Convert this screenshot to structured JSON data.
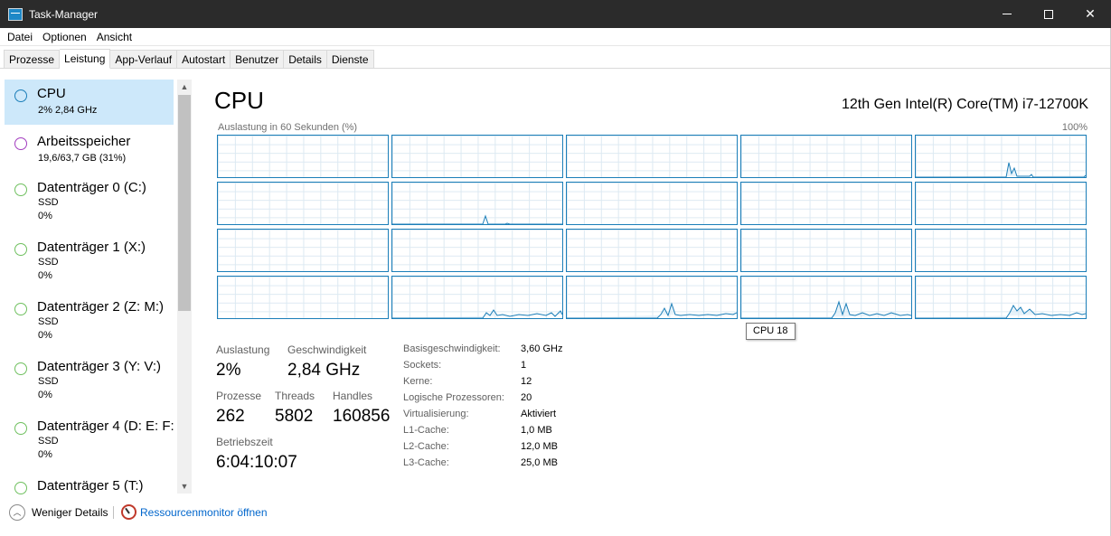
{
  "window": {
    "title": "Task-Manager"
  },
  "menu": [
    "Datei",
    "Optionen",
    "Ansicht"
  ],
  "tabs": [
    "Prozesse",
    "Leistung",
    "App-Verlauf",
    "Autostart",
    "Benutzer",
    "Details",
    "Dienste"
  ],
  "active_tab": "Leistung",
  "sidebar": {
    "items": [
      {
        "name": "CPU",
        "sub1": "2%  2,84 GHz",
        "sub2": "",
        "color": "#1b7eb8",
        "active": true
      },
      {
        "name": "Arbeitsspeicher",
        "sub1": "19,6/63,7 GB (31%)",
        "sub2": "",
        "color": "#a23cbf",
        "active": false
      },
      {
        "name": "Datenträger 0 (C:)",
        "sub1": "SSD",
        "sub2": "0%",
        "color": "#6fc05f",
        "active": false
      },
      {
        "name": "Datenträger 1 (X:)",
        "sub1": "SSD",
        "sub2": "0%",
        "color": "#6fc05f",
        "active": false
      },
      {
        "name": "Datenträger 2 (Z: M:)",
        "sub1": "SSD",
        "sub2": "0%",
        "color": "#6fc05f",
        "active": false
      },
      {
        "name": "Datenträger 3 (Y: V:)",
        "sub1": "SSD",
        "sub2": "0%",
        "color": "#6fc05f",
        "active": false
      },
      {
        "name": "Datenträger 4 (D: E: F:",
        "sub1": "SSD",
        "sub2": "0%",
        "color": "#6fc05f",
        "active": false
      },
      {
        "name": "Datenträger 5 (T:)",
        "sub1": "",
        "sub2": "",
        "color": "#6fc05f",
        "active": false
      }
    ]
  },
  "main": {
    "title": "CPU",
    "model": "12th Gen Intel(R) Core(TM) i7-12700K",
    "graph_label": "Auslastung in 60 Sekunden (%)",
    "graph_max": "100%",
    "tooltip": "CPU 18",
    "stats": {
      "auslastung_label": "Auslastung",
      "auslastung": "2%",
      "geschwindigkeit_label": "Geschwindigkeit",
      "geschwindigkeit": "2,84 GHz",
      "prozesse_label": "Prozesse",
      "prozesse": "262",
      "threads_label": "Threads",
      "threads": "5802",
      "handles_label": "Handles",
      "handles": "160856",
      "betriebszeit_label": "Betriebszeit",
      "betriebszeit": "6:04:10:07"
    },
    "specs": [
      {
        "label": "Basisgeschwindigkeit:",
        "value": "3,60 GHz"
      },
      {
        "label": "Sockets:",
        "value": "1"
      },
      {
        "label": "Kerne:",
        "value": "12"
      },
      {
        "label": "Logische Prozessoren:",
        "value": "20"
      },
      {
        "label": "Virtualisierung:",
        "value": "Aktiviert"
      },
      {
        "label": "L1-Cache:",
        "value": "1,0 MB"
      },
      {
        "label": "L2-Cache:",
        "value": "12,0 MB"
      },
      {
        "label": "L3-Cache:",
        "value": "25,0 MB"
      }
    ]
  },
  "footer": {
    "fewer_details": "Weniger Details",
    "resmon": "Ressourcenmonitor öffnen"
  },
  "colors": {
    "accent": "#1b7eb8",
    "selection": "#cde8fa",
    "link": "#0066cc"
  }
}
